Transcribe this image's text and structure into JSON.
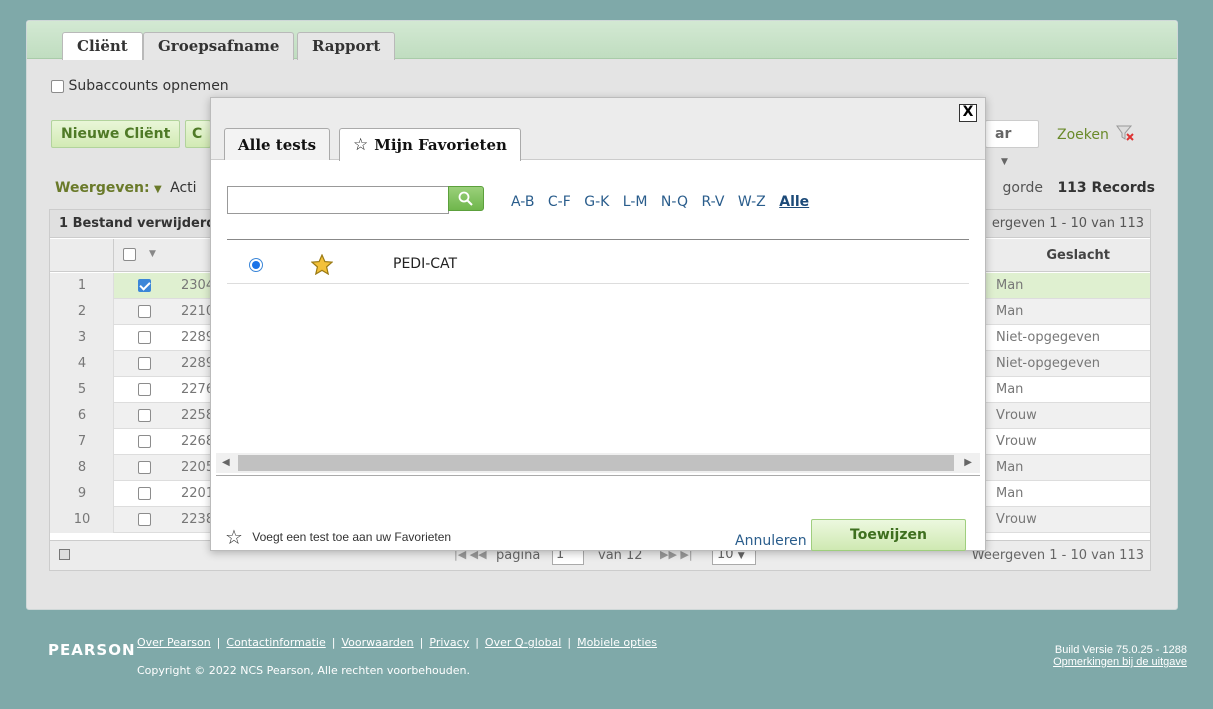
{
  "tabs": [
    "Cliënt",
    "Groepsafname",
    "Rapport"
  ],
  "subaccounts_label": "Subaccounts opnemen",
  "toolbar": {
    "new_client": "Nieuwe Cliënt",
    "c_partial": "C",
    "ar_partial": "ar",
    "zoeken": "Zoeken"
  },
  "view": {
    "label": "Weergeven:",
    "acti_partial": "Acti",
    "volgorde_partial": "gorde",
    "records": "113 Records"
  },
  "grid": {
    "notice": "1 Bestand verwijderd",
    "range_top": "ergeven 1 - 10 van 113",
    "gender_header": "Geslacht",
    "rows": [
      {
        "n": "1",
        "id": "2304",
        "checked": true,
        "gender": "Man"
      },
      {
        "n": "2",
        "id": "2210",
        "checked": false,
        "gender": "Man"
      },
      {
        "n": "3",
        "id": "2289",
        "checked": false,
        "gender": "Niet-opgegeven"
      },
      {
        "n": "4",
        "id": "2289",
        "checked": false,
        "gender": "Niet-opgegeven"
      },
      {
        "n": "5",
        "id": "2276",
        "checked": false,
        "gender": "Man"
      },
      {
        "n": "6",
        "id": "2258",
        "checked": false,
        "gender": "Vrouw"
      },
      {
        "n": "7",
        "id": "2268",
        "checked": false,
        "gender": "Vrouw"
      },
      {
        "n": "8",
        "id": "2205",
        "checked": false,
        "gender": "Man"
      },
      {
        "n": "9",
        "id": "2201",
        "checked": false,
        "gender": "Man"
      },
      {
        "n": "10",
        "id": "2238",
        "checked": false,
        "gender": "Vrouw"
      }
    ],
    "pager": {
      "pagina": "pagina",
      "page": "1",
      "van": "van 12",
      "per_page": "10"
    },
    "range_bottom": "Weergeven 1 - 10 van 113"
  },
  "modal": {
    "close": "X",
    "tab_all": "Alle tests",
    "tab_fav": "Mijn Favorieten",
    "search_value": "",
    "alpha": [
      "A-B",
      "C-F",
      "G-K",
      "L-M",
      "N-Q",
      "R-V",
      "W-Z"
    ],
    "alpha_current": "Alle",
    "tests": [
      {
        "name": "PEDI-CAT",
        "favorite": true,
        "selected": true
      }
    ],
    "footer_note": "Voegt een test toe aan uw Favorieten",
    "cancel": "Annuleren",
    "assign": "Toewijzen"
  },
  "footer": {
    "brand": "PEARSON",
    "links": [
      "Over Pearson",
      "Contactinformatie",
      "Voorwaarden",
      "Privacy",
      "Over Q-global",
      "Mobiele opties"
    ],
    "copyright": "Copyright © 2022 NCS Pearson, Alle rechten voorbehouden.",
    "build": "Build Versie 75.0.25 - 1288",
    "release_notes": "Opmerkingen bij de uitgave"
  },
  "colors": {
    "accent_green": "#4f7a27",
    "link_blue": "#2a5d8c",
    "background": "#7fa9a9"
  }
}
